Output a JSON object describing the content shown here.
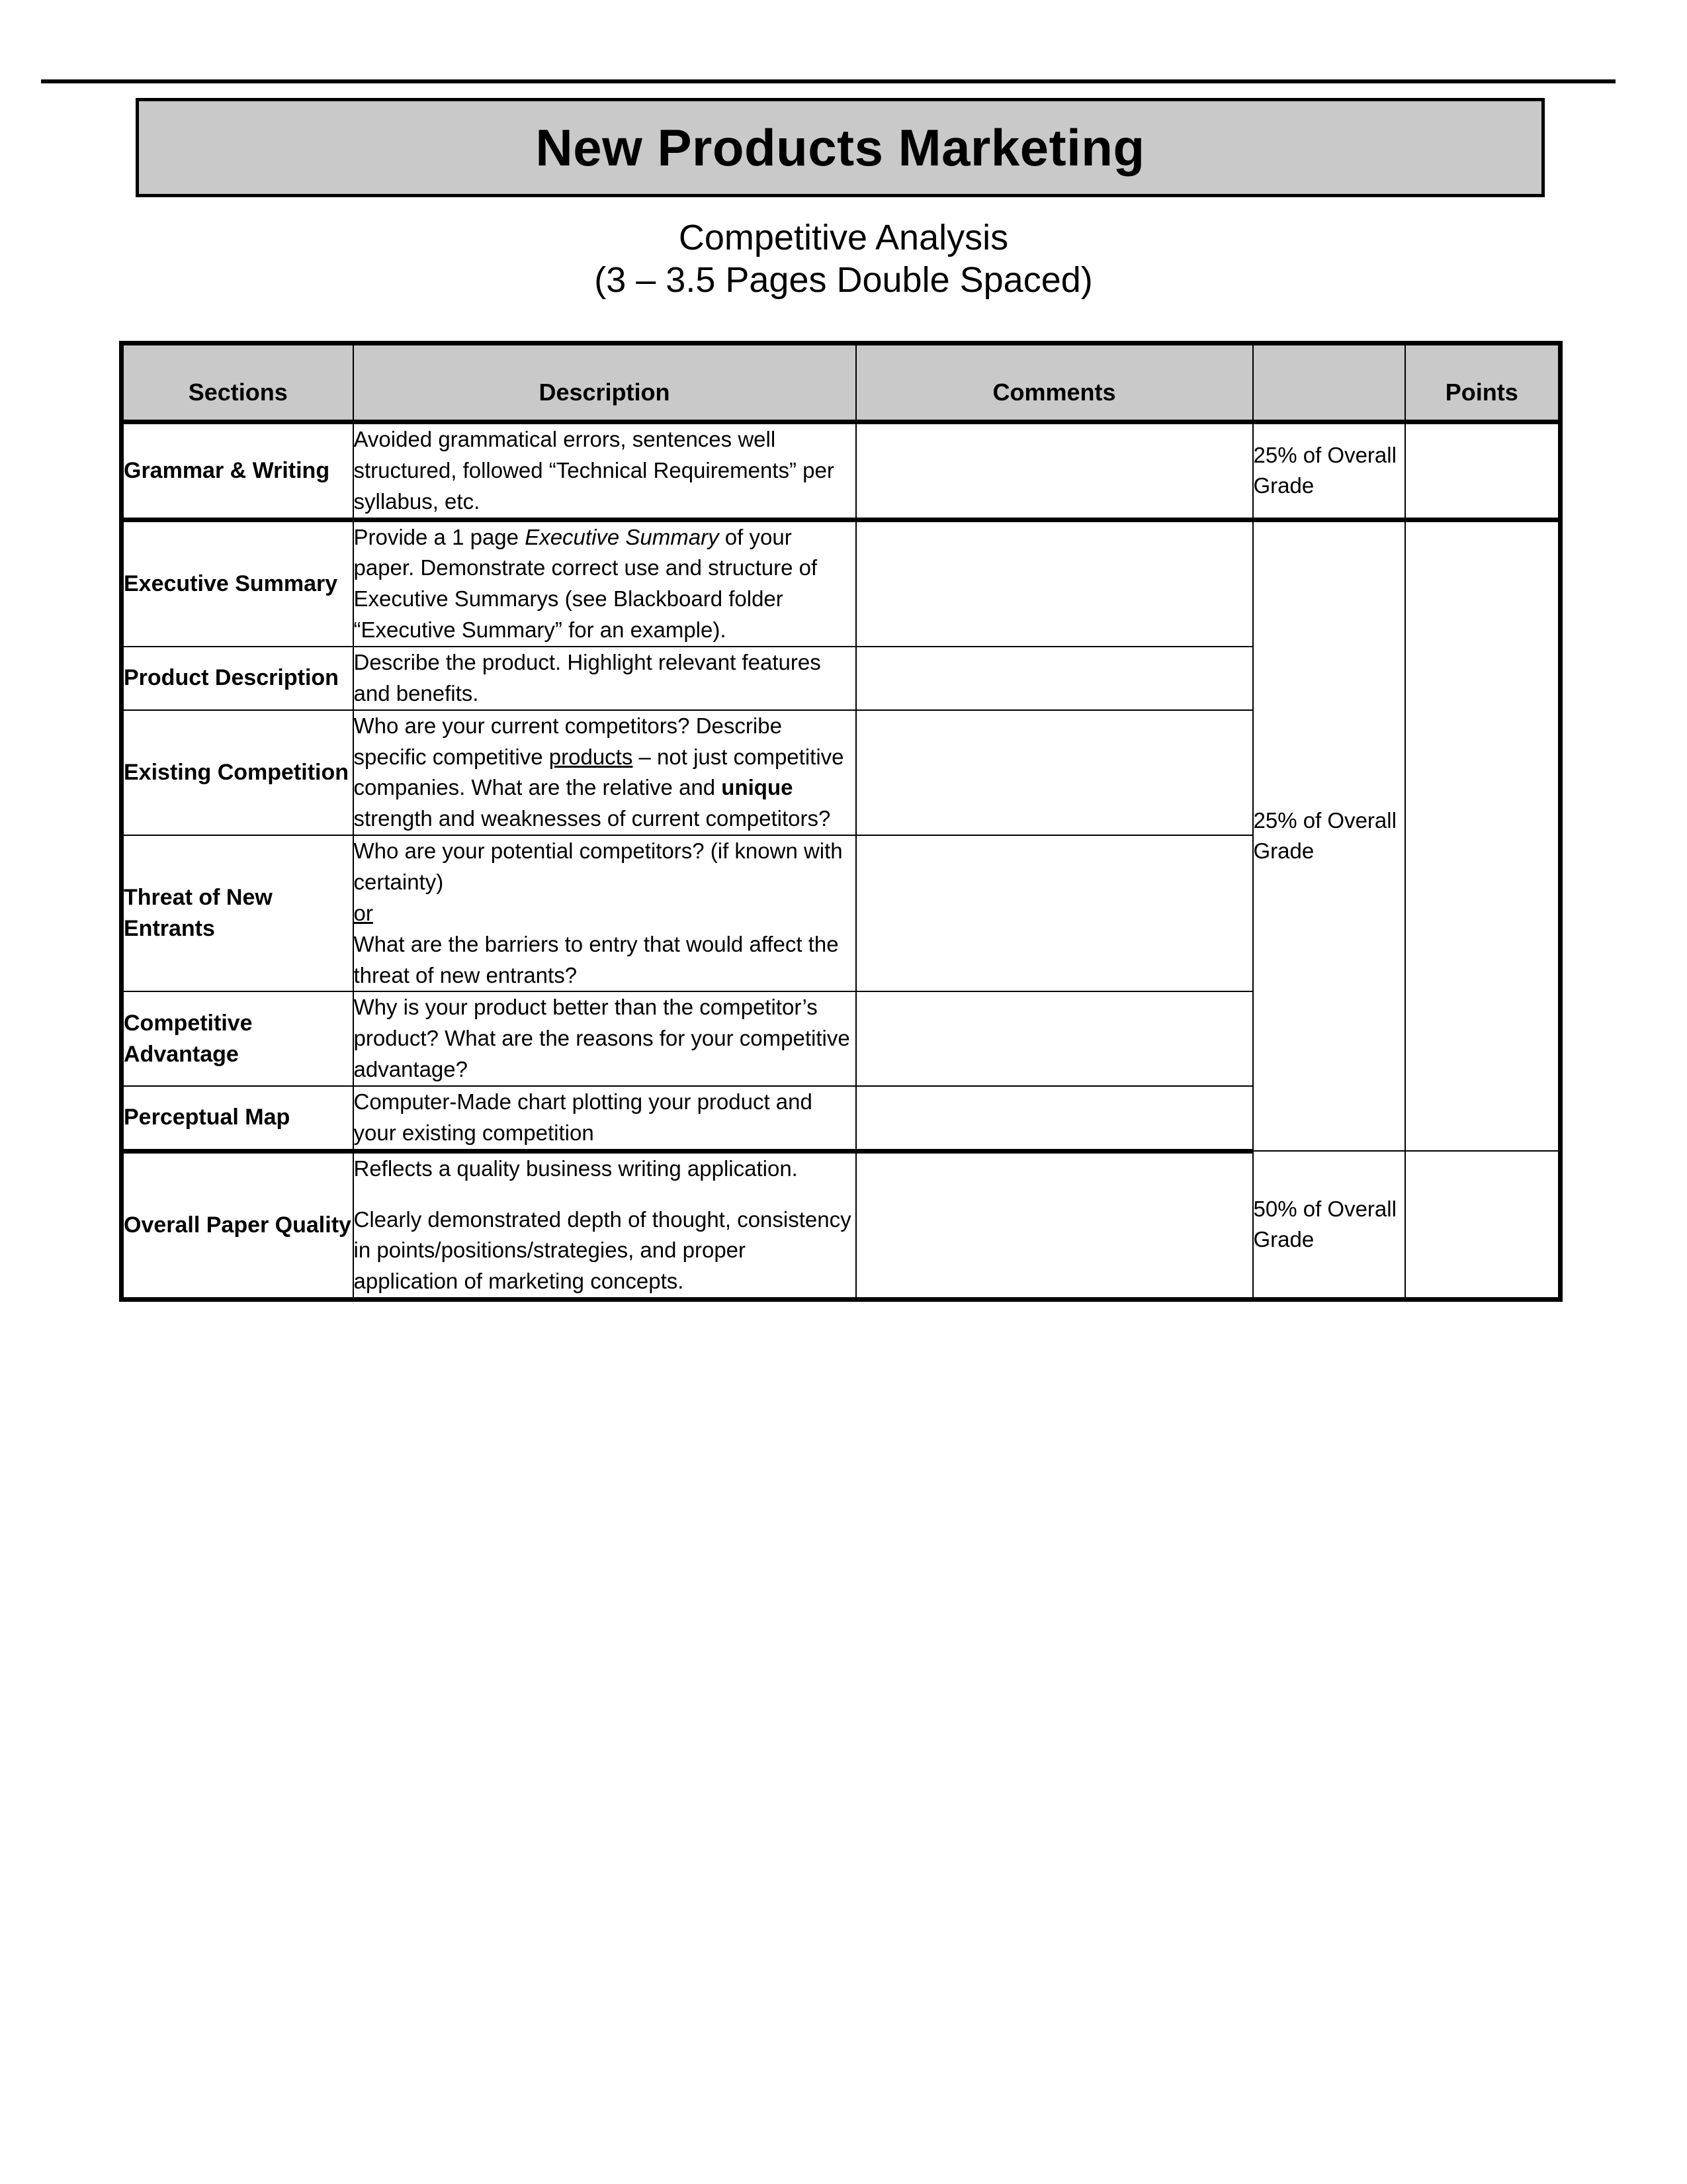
{
  "document": {
    "title": "New Products Marketing",
    "subtitle_line1": "Competitive Analysis",
    "subtitle_line2": "(3 – 3.5 Pages Double Spaced)"
  },
  "table": {
    "headers": {
      "sections": "Sections",
      "description": "Description",
      "comments": "Comments",
      "weight": "",
      "points": "Points"
    },
    "rows": [
      {
        "section": "Grammar & Writing",
        "description": "Avoided grammatical errors, sentences well structured, followed “Technical Requirements” per syllabus, etc.",
        "comments": "",
        "weight": "25% of Overall Grade",
        "points": ""
      },
      {
        "section": "Executive Summary",
        "description_part1": "Provide a 1 page ",
        "description_italic": "Executive Summary",
        "description_part2": " of your paper. Demonstrate correct use and structure of Executive Summarys (see Blackboard folder “Executive Summary” for an example).",
        "comments": "",
        "weight": "25% of Overall Grade",
        "points": ""
      },
      {
        "section": "Product Description",
        "description": "Describe the product. Highlight relevant features and benefits.",
        "comments": "",
        "points": ""
      },
      {
        "section": "Existing Competition",
        "description_part1": "Who are your current competitors? Describe specific competitive ",
        "description_underline": "products",
        "description_part2": " – not just competitive companies.  What are the relative and ",
        "description_bold": "unique",
        "description_part3": " strength and weaknesses of current competitors?",
        "comments": "",
        "points": ""
      },
      {
        "section": "Threat of New Entrants",
        "description_part1": "Who are your potential competitors? (if known with certainty)",
        "description_underline": "or",
        "description_part2": "What are the barriers to entry that would affect the threat of new entrants?",
        "comments": "",
        "points": ""
      },
      {
        "section": "Competitive Advantage",
        "description": "Why is your product better than the competitor’s product?  What are the reasons for your competitive advantage?",
        "comments": "",
        "points": ""
      },
      {
        "section": "Perceptual Map",
        "description": "Computer-Made chart plotting your product and your existing competition",
        "comments": "",
        "points": ""
      },
      {
        "section": "Overall Paper Quality",
        "description_para1": "Reflects a quality business writing application.",
        "description_para2": "Clearly demonstrated depth of thought, consistency in points/positions/strategies, and proper application of marketing concepts.",
        "comments": "",
        "weight": "50% of Overall Grade",
        "points": ""
      }
    ]
  },
  "colors": {
    "header_fill": "#c9c9c9",
    "banner_fill": "#c9c9c9",
    "border": "#000000",
    "text": "#000000"
  }
}
